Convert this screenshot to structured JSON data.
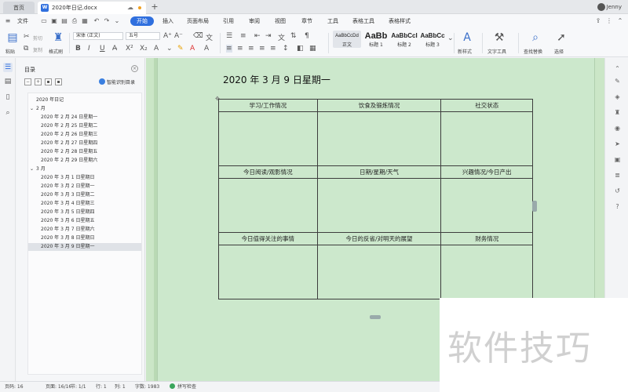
{
  "titlebar": {
    "home_tab": "首页",
    "doc_tab": "2020年日记.docx",
    "user": "Jenny"
  },
  "menubar": {
    "file": "文件",
    "active_tab": "开始",
    "items": [
      "插入",
      "页面布局",
      "引用",
      "审阅",
      "视图",
      "章节",
      "工具",
      "表格工具",
      "表格样式"
    ]
  },
  "ribbon": {
    "paste": "粘贴",
    "cut": "剪切",
    "copy": "复制",
    "format_painter": "格式刷",
    "font_name": "宋体 (正文)",
    "font_size": "五号",
    "styles": [
      {
        "sample": "AaBbCcDd",
        "name": "正文"
      },
      {
        "sample": "AaBb",
        "name": "标题 1"
      },
      {
        "sample": "AaBbCcI",
        "name": "标题 2"
      },
      {
        "sample": "AaBbCc",
        "name": "标题 3"
      }
    ],
    "new_style": "新样式",
    "text_tools": "文字工具",
    "find_replace": "查找替换",
    "select": "选择"
  },
  "toc": {
    "title": "目录",
    "smart_recognize": "智能识别目录",
    "items": [
      {
        "text": "2020 年日记",
        "level": 0,
        "caret": ""
      },
      {
        "text": "2 月",
        "level": 1,
        "caret": "⌄"
      },
      {
        "text": "2020 年 2 月 24 日星期一",
        "level": 2,
        "caret": ""
      },
      {
        "text": "2020 年 2 月 25 日星期二",
        "level": 2,
        "caret": ""
      },
      {
        "text": "2020 年 2 月 26 日星期三",
        "level": 2,
        "caret": ""
      },
      {
        "text": "2020 年 2 月 27 日星期四",
        "level": 2,
        "caret": ""
      },
      {
        "text": "2020 年 2 月 28 日星期五",
        "level": 2,
        "caret": ""
      },
      {
        "text": "2020 年 2 月 29 日星期六",
        "level": 2,
        "caret": ""
      },
      {
        "text": "3 月",
        "level": 1,
        "caret": "⌄"
      },
      {
        "text": "2020 年 3 月 1 日星期日",
        "level": 2,
        "caret": ""
      },
      {
        "text": "2020 年 3 月 2 日星期一",
        "level": 2,
        "caret": ""
      },
      {
        "text": "2020 年 3 月 3 日星期二",
        "level": 2,
        "caret": ""
      },
      {
        "text": "2020 年 3 月 4 日星期三",
        "level": 2,
        "caret": ""
      },
      {
        "text": "2020 年 3 月 5 日星期四",
        "level": 2,
        "caret": ""
      },
      {
        "text": "2020 年 3 月 6 日星期五",
        "level": 2,
        "caret": ""
      },
      {
        "text": "2020 年 3 月 7 日星期六",
        "level": 2,
        "caret": ""
      },
      {
        "text": "2020 年 3 月 8 日星期日",
        "level": 2,
        "caret": ""
      },
      {
        "text": "2020 年 3 月 9 日星期一",
        "level": 2,
        "caret": "",
        "selected": true
      }
    ]
  },
  "document": {
    "heading": "2020 年 3 月 9 日星期一",
    "table": [
      [
        "学习/工作情况",
        "饮食及锻炼情况",
        "社交状态"
      ],
      [
        "今日阅读/观影情况",
        "日期/星期/天气",
        "兴趣情况/今日产出"
      ],
      [
        "今日值得关注的事情",
        "今日的反省/对明天的展望",
        "财务情况"
      ]
    ]
  },
  "statusbar": {
    "page_num": "页码: 16",
    "pages": "页面: 16/16",
    "section": "节: 1/1",
    "row": "行: 1",
    "col": "列: 1",
    "word_count": "字数: 1983",
    "spell_check": "拼写检查"
  },
  "watermark": "软件技巧",
  "colors": {
    "accent": "#2f6fde",
    "page_bg": "#cce8cc",
    "doc_area_bg": "#cbe6c7"
  }
}
